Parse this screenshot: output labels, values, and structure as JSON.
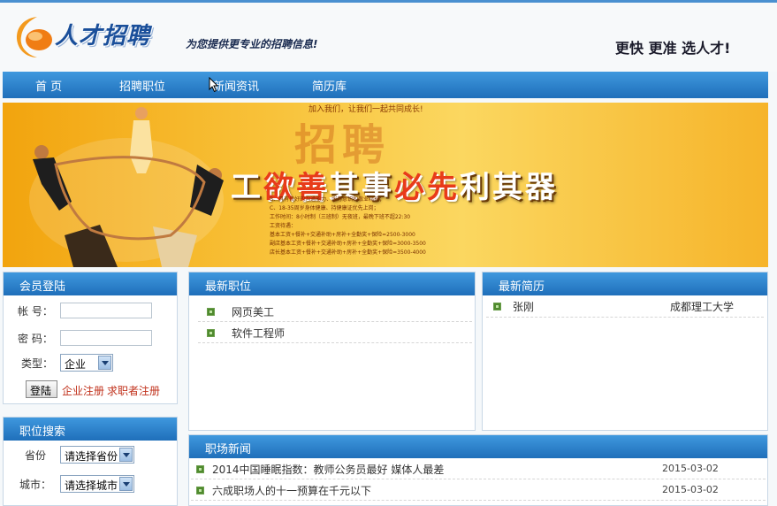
{
  "header": {
    "logo_text": "人才招聘",
    "slogan_left": "为您提供更专业的招聘信息!",
    "slogan_right": "更快 更准 选人才!"
  },
  "nav": {
    "items": [
      "首 页",
      "招聘职位",
      "新闻资讯",
      "简历库"
    ]
  },
  "banner": {
    "top_text": "加入我们，让我们一起共同成长!",
    "watermark": "招聘",
    "headline_1": "工",
    "headline_2": "欲善",
    "headline_3": "其事",
    "headline_4": "必先",
    "headline_5": "利其器",
    "lines": [
      "B、具有良好的沟通能力、服务意识和敬业精神；",
      "C、18-35周岁身体健康、持健康证优先上岗；",
      "工作时间：8小时制（三班制）无夜班，最晚下班不超22:30",
      "工资待遇：",
      "基本工资+餐补+交通补助+房补+全勤奖+保险=2500-3000",
      "副店基本工资+餐补+交通补助+房补+全勤奖+保险=3000-3500",
      "店长基本工资+餐补+交通补助+房补+全勤奖+保险=3500-4000"
    ]
  },
  "login": {
    "title": "会员登陆",
    "account_label": "帐  号：",
    "password_label": "密  码：",
    "type_label": "类型：",
    "type_value": "企业",
    "submit_label": "登陆",
    "company_register": "企业注册",
    "seeker_register": "求职者注册"
  },
  "job_search": {
    "title": "职位搜索",
    "province_label": "省份",
    "province_value": "请选择省份",
    "city_label": "城市：",
    "city_value": "请选择城市"
  },
  "latest_jobs": {
    "title": "最新职位",
    "items": [
      "网页美工",
      "软件工程师"
    ]
  },
  "latest_resumes": {
    "title": "最新简历",
    "items": [
      {
        "name": "张刚",
        "school": "成都理工大学"
      }
    ]
  },
  "career_news": {
    "title": "职场新闻",
    "items": [
      {
        "title": "2014中国睡眠指数：教师公务员最好 媒体人最差",
        "date": "2015-03-02"
      },
      {
        "title": "六成职场人的十一预算在千元以下",
        "date": "2015-03-02"
      }
    ]
  },
  "colors": {
    "nav_blue": "#2a82cc",
    "banner_orange": "#f6b42a",
    "register_red": "#c0301a"
  }
}
